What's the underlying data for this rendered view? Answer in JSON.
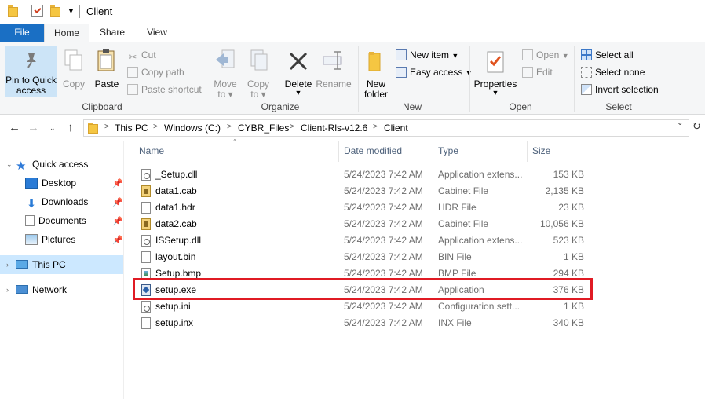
{
  "window": {
    "title": "Client"
  },
  "ribbon_tabs": [
    {
      "label": "File"
    },
    {
      "label": "Home"
    },
    {
      "label": "Share"
    },
    {
      "label": "View"
    }
  ],
  "clipboard": {
    "pin_label_1": "Pin to Quick",
    "pin_label_2": "access",
    "copy": "Copy",
    "paste": "Paste",
    "cut": "Cut",
    "copy_path": "Copy path",
    "paste_shortcut": "Paste shortcut",
    "group": "Clipboard"
  },
  "organize": {
    "move_to_1": "Move",
    "move_to_2": "to",
    "copy_to_1": "Copy",
    "copy_to_2": "to",
    "delete": "Delete",
    "rename": "Rename",
    "group": "Organize"
  },
  "new": {
    "new_folder_1": "New",
    "new_folder_2": "folder",
    "new_item": "New item",
    "easy_access": "Easy access",
    "group": "New"
  },
  "open": {
    "properties": "Properties",
    "open": "Open",
    "edit": "Edit",
    "group": "Open"
  },
  "select": {
    "select_all": "Select all",
    "select_none": "Select none",
    "invert": "Invert selection",
    "group": "Select"
  },
  "breadcrumb": [
    "This PC",
    "Windows (C:)",
    "CYBR_Files",
    "Client-Rls-v12.6",
    "Client"
  ],
  "sidebar": {
    "quick_access": "Quick access",
    "items": [
      {
        "label": "Desktop"
      },
      {
        "label": "Downloads"
      },
      {
        "label": "Documents"
      },
      {
        "label": "Pictures"
      }
    ],
    "this_pc": "This PC",
    "network": "Network"
  },
  "columns": {
    "name": "Name",
    "date": "Date modified",
    "type": "Type",
    "size": "Size"
  },
  "files": [
    {
      "name": "_Setup.dll",
      "date": "5/24/2023 7:42 AM",
      "type": "Application extens...",
      "size": "153 KB",
      "icon": "dll"
    },
    {
      "name": "data1.cab",
      "date": "5/24/2023 7:42 AM",
      "type": "Cabinet File",
      "size": "2,135 KB",
      "icon": "cab"
    },
    {
      "name": "data1.hdr",
      "date": "5/24/2023 7:42 AM",
      "type": "HDR File",
      "size": "23 KB",
      "icon": "generic"
    },
    {
      "name": "data2.cab",
      "date": "5/24/2023 7:42 AM",
      "type": "Cabinet File",
      "size": "10,056 KB",
      "icon": "cab"
    },
    {
      "name": "ISSetup.dll",
      "date": "5/24/2023 7:42 AM",
      "type": "Application extens...",
      "size": "523 KB",
      "icon": "dll"
    },
    {
      "name": "layout.bin",
      "date": "5/24/2023 7:42 AM",
      "type": "BIN File",
      "size": "1 KB",
      "icon": "generic"
    },
    {
      "name": "Setup.bmp",
      "date": "5/24/2023 7:42 AM",
      "type": "BMP File",
      "size": "294 KB",
      "icon": "bmp"
    },
    {
      "name": "setup.exe",
      "date": "5/24/2023 7:42 AM",
      "type": "Application",
      "size": "376 KB",
      "icon": "exe"
    },
    {
      "name": "setup.ini",
      "date": "5/24/2023 7:42 AM",
      "type": "Configuration sett...",
      "size": "1 KB",
      "icon": "ini"
    },
    {
      "name": "setup.inx",
      "date": "5/24/2023 7:42 AM",
      "type": "INX File",
      "size": "340 KB",
      "icon": "generic"
    }
  ],
  "colors": {
    "accent": "#1a6fc4",
    "highlight_box": "#e01b24",
    "selection": "#cce8ff"
  }
}
